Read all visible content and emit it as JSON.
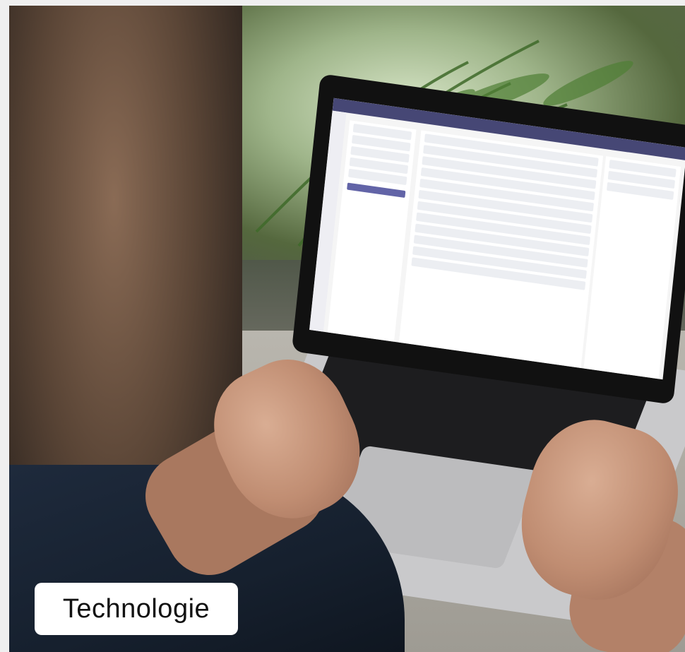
{
  "photo": {
    "description_icon": "photo-laptop-teams-calls",
    "screen_app_icon": "teams-calls-icon"
  },
  "caption": {
    "label": "Technologie"
  }
}
